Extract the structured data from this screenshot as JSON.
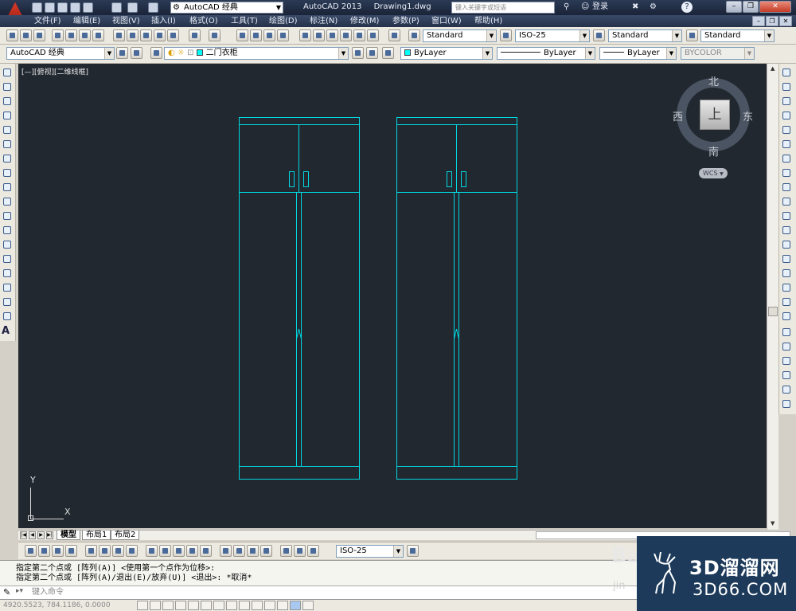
{
  "titlebar": {
    "workspace": "AutoCAD 经典",
    "app_name": "AutoCAD 2013",
    "file_name": "Drawing1.dwg",
    "search_placeholder": "键入关键字或短语",
    "login": "登录",
    "help": "?"
  },
  "menu": [
    "文件(F)",
    "编辑(E)",
    "视图(V)",
    "插入(I)",
    "格式(O)",
    "工具(T)",
    "绘图(D)",
    "标注(N)",
    "修改(M)",
    "参数(P)",
    "窗口(W)",
    "帮助(H)"
  ],
  "toolbar1": {
    "text_style": "Standard",
    "dim_style": "ISO-25",
    "table_style": "Standard",
    "multileader_style": "Standard"
  },
  "toolbar2": {
    "workspace": "AutoCAD 经典",
    "layer": "二门衣柜",
    "color": "ByLayer",
    "linetype": "ByLayer",
    "lineweight": "ByLayer",
    "plotstyle": "BYCOLOR"
  },
  "viewport": {
    "label": "[—][俯视][二维线框]"
  },
  "viewcube": {
    "north": "北",
    "south": "南",
    "east": "东",
    "west": "西",
    "face": "上",
    "wcs": "WCS"
  },
  "ucs": {
    "x": "X",
    "y": "Y"
  },
  "tabs": [
    "模型",
    "布局1",
    "布局2"
  ],
  "dim_toolbar": {
    "dim_style": "ISO-25"
  },
  "command": {
    "line1": "指定第二个点或 [阵列(A)] <使用第一个点作为位移>:",
    "line2": "指定第二个点或 [阵列(A)/退出(E)/放弃(U)] <退出>: *取消*",
    "input_placeholder": "键入命令"
  },
  "status": {
    "coords": "4920.5523, 784.1186, 0.0000"
  },
  "watermark": {
    "title": "3D溜溜网",
    "url": "3D66.COM",
    "baidu": "Bai",
    "baidu_sub": "jin"
  },
  "colors": {
    "canvas_bg": "#212830",
    "drawing_line": "#00d8e0",
    "titlebar": "#2b3a55"
  }
}
